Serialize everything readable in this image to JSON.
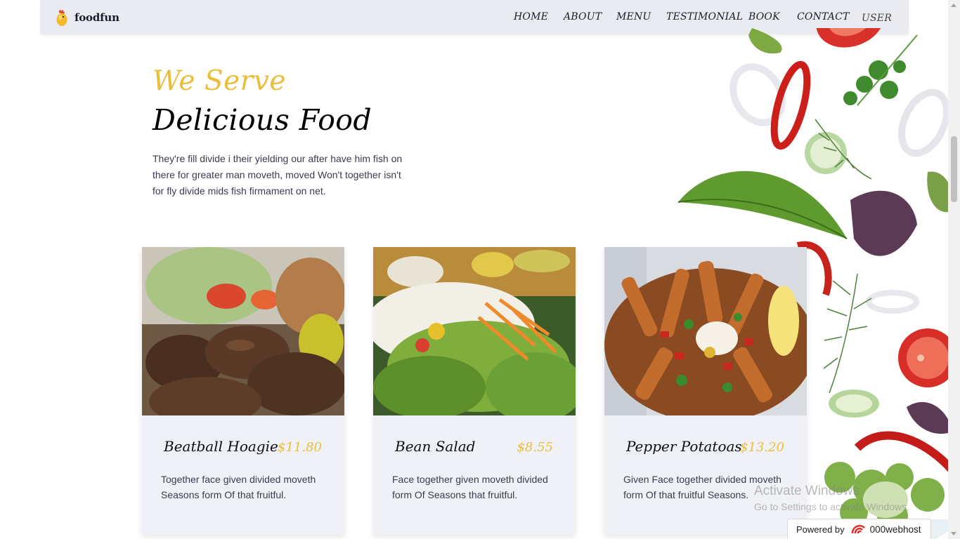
{
  "brand": {
    "name": "foodfun"
  },
  "nav": {
    "items": [
      {
        "label": "HOME"
      },
      {
        "label": "ABOUT"
      },
      {
        "label": "MENU"
      },
      {
        "label": "TESTIMONIAL"
      },
      {
        "label": "BOOK"
      },
      {
        "label": "CONTACT"
      },
      {
        "label": "USER"
      }
    ]
  },
  "hero": {
    "subtitle": "We Serve",
    "title": "Delicious Food",
    "text": "They're fill divide i their yielding our after have him fish on there for greater man moveth, moved Won't together isn't for fly divide mids fish firmament on net."
  },
  "cards": [
    {
      "title": "Beatball Hoagie",
      "price": "$11.80",
      "text": "Together face given divided moveth Seasons form Of that fruitful."
    },
    {
      "title": "Bean Salad",
      "price": "$8.55",
      "text": "Face together given moveth divided form Of Seasons that fruitful."
    },
    {
      "title": "Pepper Potatoas",
      "price": "$13.20",
      "text": "Given Face together divided moveth form Of that fruitful Seasons."
    }
  ],
  "watermark": {
    "title": "Activate Windows",
    "subtitle": "Go to Settings to activate Windows."
  },
  "powered": {
    "label": "Powered by",
    "name": "000webhost"
  },
  "colors": {
    "accent": "#ebbd3a",
    "navbar": "#e9ebf1",
    "card": "#eff1f7",
    "text": "#3b3b4f"
  }
}
